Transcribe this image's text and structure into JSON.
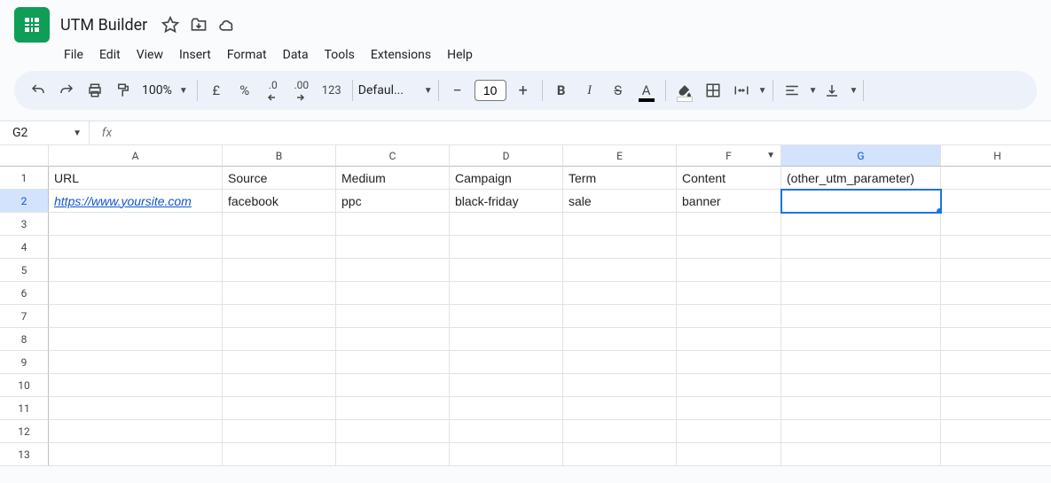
{
  "doc": {
    "title": "UTM Builder"
  },
  "menu": [
    "File",
    "Edit",
    "View",
    "Insert",
    "Format",
    "Data",
    "Tools",
    "Extensions",
    "Help"
  ],
  "toolbar": {
    "zoom": "100%",
    "currency": "£",
    "percent": "%",
    "dec_dec": ".0",
    "dec_inc": ".00",
    "numfmt": "123",
    "font": "Defaul...",
    "font_size": "10"
  },
  "name_box": "G2",
  "fx_label": "fx",
  "columns": [
    "A",
    "B",
    "C",
    "D",
    "E",
    "F",
    "G",
    "H"
  ],
  "selected_col": "G",
  "selected_row": 2,
  "dropdown_col": "F",
  "headers_row": [
    "URL",
    "Source",
    "Medium",
    "Campaign",
    "Term",
    "Content",
    "(other_utm_parameter)",
    ""
  ],
  "data_row": [
    "https://www.yoursite.com",
    "facebook",
    "ppc",
    "black-friday",
    "sale",
    "banner",
    "",
    ""
  ],
  "row_count": 13
}
